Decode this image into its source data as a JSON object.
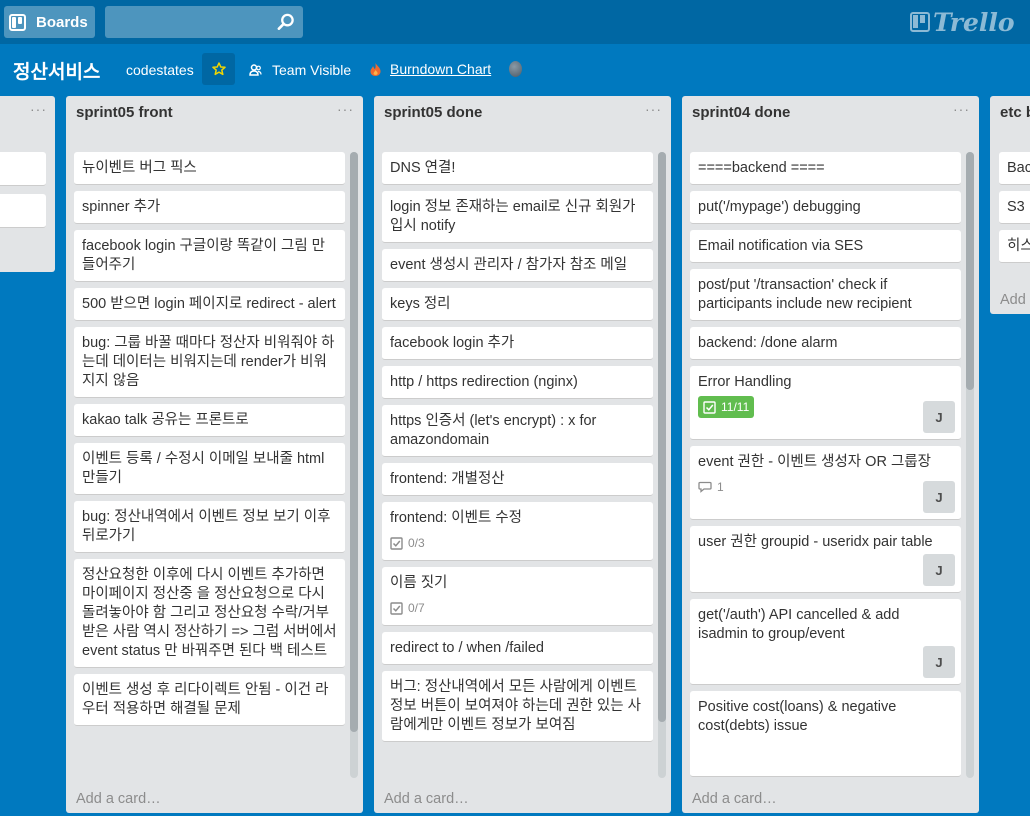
{
  "topbar": {
    "boards_label": "Boards",
    "search_value": "",
    "logo_text": "Trello"
  },
  "board": {
    "title": "정산서비스",
    "org": "codestates",
    "visibility": "Team Visible",
    "burndown": "Burndown Chart"
  },
  "lists": {
    "sprint05_front": {
      "title": "sprint05 front",
      "menu": "···",
      "add_card": "Add a card…",
      "cards": [
        "뉴이벤트 버그 픽스",
        "spinner 추가",
        "facebook login 구글이랑 똑같이 그림 만들어주기",
        "500 받으면 login 페이지로 redirect - alert",
        "bug: 그룹 바꿀 때마다 정산자 비워줘야 하는데 데이터는 비워지는데 render가 비워지지 않음",
        "kakao talk 공유는 프론트로",
        "이벤트 등록 / 수정시 이메일 보내줄 html 만들기",
        "bug: 정산내역에서 이벤트 정보 보기 이후 뒤로가기",
        "정산요청한 이후에 다시 이벤트 추가하면 마이페이지 정산중 을 정산요청으로 다시 돌려놓아야 함 그리고 정산요청 수락/거부 받은 사람 역시 정산하기 => 그럼 서버에서 event status 만 바꿔주면 된다 백 테스트",
        "이벤트 생성 후 리다이렉트 안됨 - 이건 라우터 적용하면 해결될 문제"
      ]
    },
    "sprint05_done": {
      "title": "sprint05 done",
      "menu": "···",
      "add_card": "Add a card…",
      "cards": [
        {
          "text": "DNS 연결!"
        },
        {
          "text": "login 정보 존재하는 email로 신규 회원가입시 notify"
        },
        {
          "text": "event 생성시 관리자 / 참가자 참조 메일"
        },
        {
          "text": "keys 정리"
        },
        {
          "text": "facebook login 추가"
        },
        {
          "text": "http / https redirection (nginx)"
        },
        {
          "text": "https 인증서 (let's encrypt) : x for amazondomain"
        },
        {
          "text": "frontend: 개별정산"
        },
        {
          "text": "frontend: 이벤트 수정",
          "checklist": "0/3"
        },
        {
          "text": "이름 짓기",
          "checklist": "0/7"
        },
        {
          "text": "redirect to / when /failed"
        },
        {
          "text": "버그: 정산내역에서 모든 사람에게 이벤트 정보 버튼이 보여져야 하는데 권한 있는 사람에게만 이벤트 정보가 보여짐"
        }
      ]
    },
    "sprint04_done": {
      "title": "sprint04 done",
      "menu": "···",
      "add_card": "Add a card…",
      "cards": [
        {
          "text": "====backend ===="
        },
        {
          "text": "put('/mypage') debugging"
        },
        {
          "text": "Email notification via SES"
        },
        {
          "text": "post/put '/transaction' check if participants include new recipient"
        },
        {
          "text": "backend: /done alarm"
        },
        {
          "text": "Error Handling",
          "checklist_done": "11/11",
          "member": "J"
        },
        {
          "text": "event 권한 - 이벤트 생성자 OR 그룹장",
          "comments": "1",
          "member": "J"
        },
        {
          "text": "user 권한 groupid - useridx pair table",
          "member": "J"
        },
        {
          "text": "get('/auth') API cancelled & add isadmin to group/event",
          "member": "J"
        },
        {
          "text": "Positive cost(loans) & negative cost(debts) issue"
        }
      ]
    },
    "etc": {
      "title": "etc b",
      "add_card": "Add",
      "cards": [
        "Bac",
        "S3",
        "히스"
      ]
    }
  },
  "colors": {
    "board_bg": "#0079bf",
    "header_bg": "#0067a3",
    "list_bg": "#e2e4e6",
    "checklist_complete": "#61bd4f"
  }
}
